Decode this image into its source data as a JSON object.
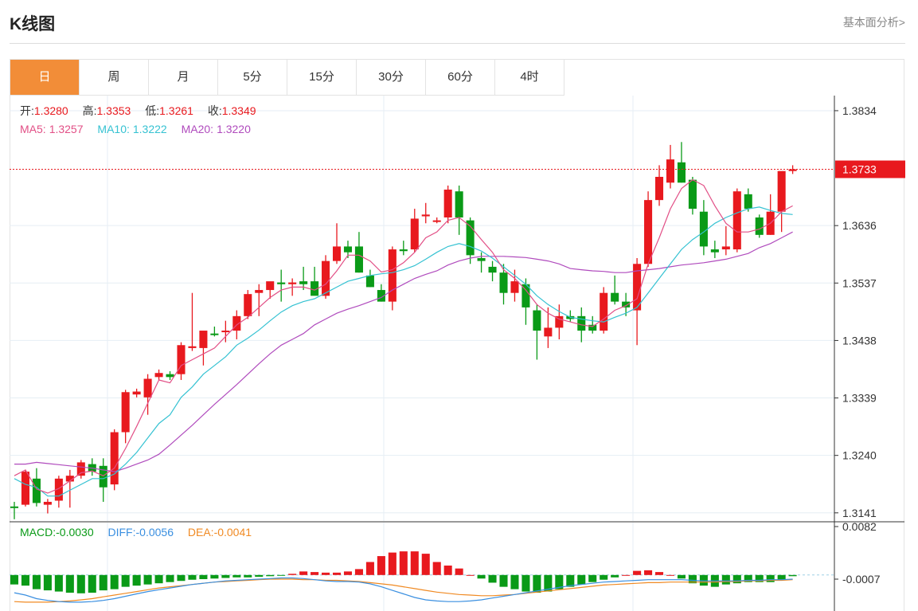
{
  "header": {
    "title": "K线图",
    "link": "基本面分析>"
  },
  "tabs": [
    {
      "label": "日",
      "active": true
    },
    {
      "label": "周",
      "active": false
    },
    {
      "label": "月",
      "active": false
    },
    {
      "label": "5分",
      "active": false
    },
    {
      "label": "15分",
      "active": false
    },
    {
      "label": "30分",
      "active": false
    },
    {
      "label": "60分",
      "active": false
    },
    {
      "label": "4时",
      "active": false
    }
  ],
  "ohlc": {
    "open_label": "开:",
    "open": "1.3280",
    "high_label": "高:",
    "high": "1.3353",
    "low_label": "低:",
    "low": "1.3261",
    "close_label": "收:",
    "close": "1.3349"
  },
  "ma": {
    "ma5_label": "MA5:",
    "ma5": "1.3257",
    "ma10_label": "MA10:",
    "ma10": "1.3222",
    "ma20_label": "MA20:",
    "ma20": "1.3220"
  },
  "macd_info": {
    "macd_label": "MACD:",
    "macd": "-0.0030",
    "diff_label": "DIFF:",
    "diff": "-0.0056",
    "dea_label": "DEA:",
    "dea": "-0.0041"
  },
  "colors": {
    "up": "#e8191e",
    "down": "#0a9a17",
    "ma5": "#e24f86",
    "ma10": "#35c2d2",
    "ma20": "#b04bbd",
    "diff": "#3a8fe0",
    "dea": "#f08a23",
    "accent": "#f28d38",
    "grid": "#e6eef4",
    "current": "#e8191e"
  },
  "chart_data": {
    "type": "candlestick",
    "y_ticks": [
      "1.3834",
      "1.3733",
      "1.3636",
      "1.3537",
      "1.3438",
      "1.3339",
      "1.3240",
      "1.3141"
    ],
    "ylim": [
      1.3127,
      1.386
    ],
    "current_price": "1.3733",
    "candles": [
      [
        1.3152,
        1.316,
        1.313,
        1.315
      ],
      [
        1.3155,
        1.3215,
        1.3152,
        1.3212
      ],
      [
        1.32,
        1.3218,
        1.3152,
        1.3158
      ],
      [
        1.3155,
        1.3165,
        1.314,
        1.316
      ],
      [
        1.3162,
        1.3205,
        1.315,
        1.32
      ],
      [
        1.3195,
        1.3215,
        1.315,
        1.3205
      ],
      [
        1.3205,
        1.3232,
        1.32,
        1.3228
      ],
      [
        1.3225,
        1.3235,
        1.3205,
        1.3212
      ],
      [
        1.3222,
        1.3235,
        1.316,
        1.3185
      ],
      [
        1.319,
        1.3285,
        1.318,
        1.328
      ],
      [
        1.328,
        1.3353,
        1.3261,
        1.3349
      ],
      [
        1.3345,
        1.3355,
        1.334,
        1.335
      ],
      [
        1.334,
        1.338,
        1.331,
        1.3372
      ],
      [
        1.3375,
        1.3388,
        1.337,
        1.3382
      ],
      [
        1.338,
        1.3385,
        1.337,
        1.3375
      ],
      [
        1.338,
        1.3435,
        1.337,
        1.343
      ],
      [
        1.3425,
        1.352,
        1.342,
        1.3428
      ],
      [
        1.3425,
        1.3445,
        1.3395,
        1.3455
      ],
      [
        1.345,
        1.3462,
        1.3445,
        1.3448
      ],
      [
        1.3455,
        1.3472,
        1.3435,
        1.3455
      ],
      [
        1.3455,
        1.349,
        1.344,
        1.348
      ],
      [
        1.348,
        1.3525,
        1.3475,
        1.3518
      ],
      [
        1.352,
        1.3535,
        1.348,
        1.3525
      ],
      [
        1.3525,
        1.3535,
        1.351,
        1.354
      ],
      [
        1.3538,
        1.356,
        1.3505,
        1.3535
      ],
      [
        1.3535,
        1.3545,
        1.3515,
        1.3538
      ],
      [
        1.354,
        1.3565,
        1.3525,
        1.3535
      ],
      [
        1.354,
        1.3565,
        1.352,
        1.3515
      ],
      [
        1.3515,
        1.3585,
        1.351,
        1.3575
      ],
      [
        1.3575,
        1.364,
        1.357,
        1.36
      ],
      [
        1.36,
        1.361,
        1.358,
        1.359
      ],
      [
        1.36,
        1.3625,
        1.3555,
        1.3555
      ],
      [
        1.355,
        1.356,
        1.353,
        1.353
      ],
      [
        1.3525,
        1.3535,
        1.3505,
        1.3505
      ],
      [
        1.3505,
        1.36,
        1.349,
        1.3595
      ],
      [
        1.3595,
        1.361,
        1.3585,
        1.3592
      ],
      [
        1.3595,
        1.3665,
        1.359,
        1.3648
      ],
      [
        1.3652,
        1.3675,
        1.364,
        1.3655
      ],
      [
        1.3645,
        1.365,
        1.364,
        1.3645
      ],
      [
        1.365,
        1.3705,
        1.364,
        1.3698
      ],
      [
        1.3695,
        1.3705,
        1.362,
        1.365
      ],
      [
        1.3645,
        1.365,
        1.357,
        1.3585
      ],
      [
        1.358,
        1.359,
        1.3555,
        1.3575
      ],
      [
        1.3565,
        1.3575,
        1.354,
        1.3555
      ],
      [
        1.3555,
        1.357,
        1.35,
        1.352
      ],
      [
        1.352,
        1.356,
        1.3505,
        1.354
      ],
      [
        1.3535,
        1.3545,
        1.3465,
        1.3495
      ],
      [
        1.349,
        1.35,
        1.3405,
        1.3455
      ],
      [
        1.3445,
        1.3495,
        1.3425,
        1.346
      ],
      [
        1.346,
        1.35,
        1.344,
        1.348
      ],
      [
        1.348,
        1.349,
        1.347,
        1.3475
      ],
      [
        1.348,
        1.3495,
        1.3435,
        1.3455
      ],
      [
        1.3465,
        1.348,
        1.345,
        1.3455
      ],
      [
        1.3455,
        1.353,
        1.345,
        1.352
      ],
      [
        1.352,
        1.355,
        1.35,
        1.3505
      ],
      [
        1.3505,
        1.352,
        1.348,
        1.3495
      ],
      [
        1.349,
        1.358,
        1.343,
        1.357
      ],
      [
        1.357,
        1.3695,
        1.3565,
        1.368
      ],
      [
        1.368,
        1.374,
        1.367,
        1.372
      ],
      [
        1.371,
        1.3775,
        1.37,
        1.375
      ],
      [
        1.3745,
        1.378,
        1.371,
        1.371
      ],
      [
        1.3715,
        1.372,
        1.3655,
        1.3665
      ],
      [
        1.366,
        1.368,
        1.3585,
        1.36
      ],
      [
        1.3595,
        1.361,
        1.358,
        1.359
      ],
      [
        1.3595,
        1.3635,
        1.3585,
        1.36
      ],
      [
        1.3595,
        1.37,
        1.359,
        1.3695
      ],
      [
        1.369,
        1.37,
        1.366,
        1.3665
      ],
      [
        1.365,
        1.3655,
        1.3615,
        1.362
      ],
      [
        1.362,
        1.369,
        1.362,
        1.366
      ],
      [
        1.366,
        1.3725,
        1.3625,
        1.373
      ],
      [
        1.373,
        1.374,
        1.3725,
        1.3733
      ]
    ],
    "ma5": [
      1.3205,
      1.3215,
      1.3182,
      1.3175,
      1.3183,
      1.3196,
      1.321,
      1.3213,
      1.3205,
      1.3218,
      1.3252,
      1.329,
      1.333,
      1.337,
      1.3365,
      1.3395,
      1.3405,
      1.3415,
      1.3425,
      1.3445,
      1.3465,
      1.3478,
      1.3495,
      1.3512,
      1.3525,
      1.353,
      1.353,
      1.3525,
      1.3535,
      1.3558,
      1.3585,
      1.3585,
      1.3575,
      1.3556,
      1.356,
      1.3572,
      1.359,
      1.3615,
      1.3625,
      1.3645,
      1.365,
      1.3635,
      1.3612,
      1.359,
      1.356,
      1.3545,
      1.3525,
      1.35,
      1.3485,
      1.3475,
      1.347,
      1.3465,
      1.3462,
      1.3475,
      1.349,
      1.3498,
      1.351,
      1.357,
      1.3615,
      1.3665,
      1.37,
      1.3715,
      1.3705,
      1.367,
      1.364,
      1.3625,
      1.3625,
      1.363,
      1.364,
      1.366,
      1.367
    ],
    "ma10": [
      1.32,
      1.319,
      1.3185,
      1.317,
      1.317,
      1.318,
      1.319,
      1.32,
      1.32,
      1.3208,
      1.3225,
      1.3245,
      1.327,
      1.3295,
      1.331,
      1.334,
      1.3358,
      1.338,
      1.3395,
      1.341,
      1.343,
      1.3442,
      1.3456,
      1.3472,
      1.3487,
      1.3498,
      1.3505,
      1.351,
      1.352,
      1.353,
      1.354,
      1.3545,
      1.355,
      1.3553,
      1.3555,
      1.356,
      1.3567,
      1.3578,
      1.359,
      1.36,
      1.3605,
      1.36,
      1.3592,
      1.358,
      1.3565,
      1.355,
      1.3535,
      1.3515,
      1.35,
      1.3488,
      1.3478,
      1.3475,
      1.3472,
      1.347,
      1.3478,
      1.3485,
      1.3495,
      1.352,
      1.3545,
      1.357,
      1.3595,
      1.3612,
      1.3625,
      1.364,
      1.365,
      1.3658,
      1.3665,
      1.3668,
      1.3662,
      1.3657,
      1.3655
    ],
    "ma20": [
      1.3225,
      1.3225,
      1.3228,
      1.3226,
      1.3224,
      1.3222,
      1.322,
      1.3218,
      1.3215,
      1.3212,
      1.3218,
      1.3225,
      1.3232,
      1.3242,
      1.3258,
      1.3275,
      1.3292,
      1.331,
      1.3328,
      1.3345,
      1.3362,
      1.338,
      1.3398,
      1.3415,
      1.343,
      1.344,
      1.345,
      1.3465,
      1.3475,
      1.3485,
      1.3492,
      1.3498,
      1.3505,
      1.3512,
      1.3525,
      1.3535,
      1.3545,
      1.3552,
      1.3558,
      1.3568,
      1.3575,
      1.358,
      1.3583,
      1.3583,
      1.3583,
      1.3582,
      1.3581,
      1.3578,
      1.3575,
      1.357,
      1.3562,
      1.356,
      1.3558,
      1.3557,
      1.3555,
      1.3555,
      1.3558,
      1.356,
      1.3562,
      1.3565,
      1.3568,
      1.357,
      1.3572,
      1.3575,
      1.3578,
      1.3583,
      1.3588,
      1.3598,
      1.3605,
      1.3615,
      1.3625
    ],
    "macd_hist": [
      -0.0016,
      -0.0018,
      -0.0024,
      -0.0026,
      -0.0028,
      -0.003,
      -0.0031,
      -0.003,
      -0.0026,
      -0.0024,
      -0.002,
      -0.0018,
      -0.0016,
      -0.0014,
      -0.0012,
      -0.001,
      -0.0008,
      -0.0007,
      -0.0006,
      -0.0005,
      -0.0004,
      -0.0004,
      -0.0003,
      -0.0002,
      -0.0001,
      0.0002,
      0.0006,
      0.0005,
      0.0004,
      0.0004,
      0.0006,
      0.001,
      0.0022,
      0.0032,
      0.0038,
      0.004,
      0.004,
      0.0036,
      0.0022,
      0.0016,
      0.0011,
      0.0,
      -0.0006,
      -0.0013,
      -0.002,
      -0.0024,
      -0.0028,
      -0.003,
      -0.0028,
      -0.0024,
      -0.002,
      -0.0016,
      -0.0012,
      -0.0008,
      -0.0004,
      0.0,
      0.0007,
      0.0008,
      0.0005,
      0.0,
      -0.0006,
      -0.0014,
      -0.0018,
      -0.002,
      -0.0016,
      -0.0014,
      -0.0012,
      -0.0012,
      -0.0012,
      -0.0008,
      -0.0002
    ],
    "diff_line": [
      -0.003,
      -0.0034,
      -0.004,
      -0.0043,
      -0.0045,
      -0.0046,
      -0.0046,
      -0.0045,
      -0.0043,
      -0.004,
      -0.0036,
      -0.0032,
      -0.0028,
      -0.0025,
      -0.0022,
      -0.0019,
      -0.0016,
      -0.0014,
      -0.0012,
      -0.001,
      -0.0009,
      -0.0008,
      -0.0007,
      -0.0006,
      -0.0005,
      -0.0005,
      -0.0006,
      -0.0008,
      -0.001,
      -0.0011,
      -0.0011,
      -0.0012,
      -0.0015,
      -0.002,
      -0.0026,
      -0.0032,
      -0.0038,
      -0.0042,
      -0.0044,
      -0.0045,
      -0.0045,
      -0.0044,
      -0.0042,
      -0.0039,
      -0.0036,
      -0.0033,
      -0.003,
      -0.0027,
      -0.0024,
      -0.0021,
      -0.0018,
      -0.0016,
      -0.0014,
      -0.0012,
      -0.0011,
      -0.001,
      -0.0009,
      -0.0008,
      -0.0008,
      -0.0008,
      -0.0008,
      -0.0009,
      -0.001,
      -0.001,
      -0.001,
      -0.001,
      -0.0009,
      -0.0009,
      -0.0008,
      -0.0008,
      -0.0007
    ],
    "dea_line": [
      -0.0045,
      -0.0046,
      -0.0046,
      -0.0046,
      -0.0045,
      -0.0044,
      -0.0042,
      -0.004,
      -0.0037,
      -0.0034,
      -0.0031,
      -0.0028,
      -0.0025,
      -0.0022,
      -0.002,
      -0.0018,
      -0.0016,
      -0.0014,
      -0.0012,
      -0.0011,
      -0.001,
      -0.0009,
      -0.0008,
      -0.0007,
      -0.0007,
      -0.0007,
      -0.0008,
      -0.0008,
      -0.0009,
      -0.0009,
      -0.001,
      -0.0011,
      -0.0013,
      -0.0015,
      -0.0017,
      -0.002,
      -0.0023,
      -0.0026,
      -0.0029,
      -0.0031,
      -0.0033,
      -0.0034,
      -0.0035,
      -0.0035,
      -0.0034,
      -0.0033,
      -0.0031,
      -0.0029,
      -0.0027,
      -0.0025,
      -0.0023,
      -0.0021,
      -0.0019,
      -0.0017,
      -0.0016,
      -0.0015,
      -0.0014,
      -0.0013,
      -0.0013,
      -0.0012,
      -0.0012,
      -0.0012,
      -0.0012,
      -0.0012,
      -0.0011,
      -0.0011,
      -0.001,
      -0.001,
      -0.0009,
      -0.0009,
      -0.0008
    ],
    "macd_ticks": [
      "0.0082",
      "-0.0007"
    ],
    "macd_ylim": [
      -0.0045,
      0.0082
    ]
  }
}
